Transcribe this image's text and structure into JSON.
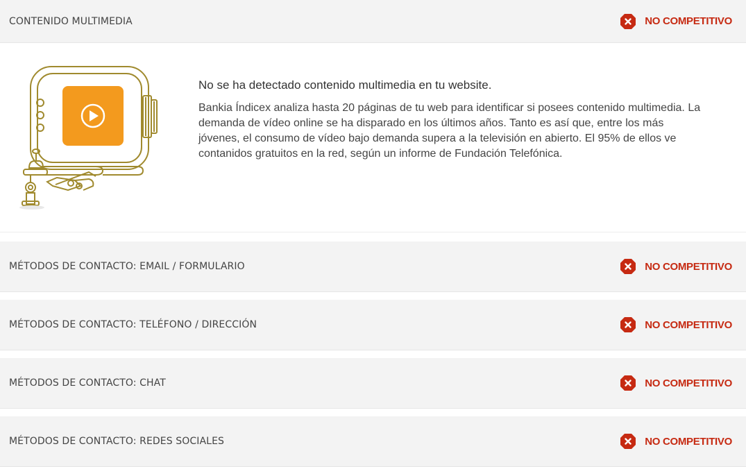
{
  "sections": [
    {
      "title": "CONTENIDO MULTIMEDIA",
      "status": "NO COMPETITIVO",
      "expanded": true,
      "detail": {
        "headline": "No se ha detectado contenido multimedia en tu website.",
        "body": "Bankia Índicex analiza hasta 20 páginas de tu web para identificar si posees contenido multimedia. La demanda de vídeo online se ha disparado en los últimos años. Tanto es así que, entre los más jóvenes, el consumo de vídeo bajo demanda supera a la televisión en abierto. El 95% de ellos ve contanidos gratuitos en la red, según un informe de Fundación Telefónica.",
        "illustration": "video-camera-illustration"
      }
    },
    {
      "title": "MÉTODOS DE CONTACTO: EMAIL / FORMULARIO",
      "status": "NO COMPETITIVO",
      "expanded": false
    },
    {
      "title": "MÉTODOS DE CONTACTO: TELÉFONO / DIRECCIÓN",
      "status": "NO COMPETITIVO",
      "expanded": false
    },
    {
      "title": "MÉTODOS DE CONTACTO: CHAT",
      "status": "NO COMPETITIVO",
      "expanded": false
    },
    {
      "title": "MÉTODOS DE CONTACTO: REDES SOCIALES",
      "status": "NO COMPETITIVO",
      "expanded": false
    }
  ],
  "colors": {
    "status_red": "#c62a12",
    "row_background": "#f3f3f3",
    "illustration_outline": "#a08a2e",
    "screen_orange": "#f39a1e"
  },
  "icons": {
    "status": "close-icon"
  }
}
